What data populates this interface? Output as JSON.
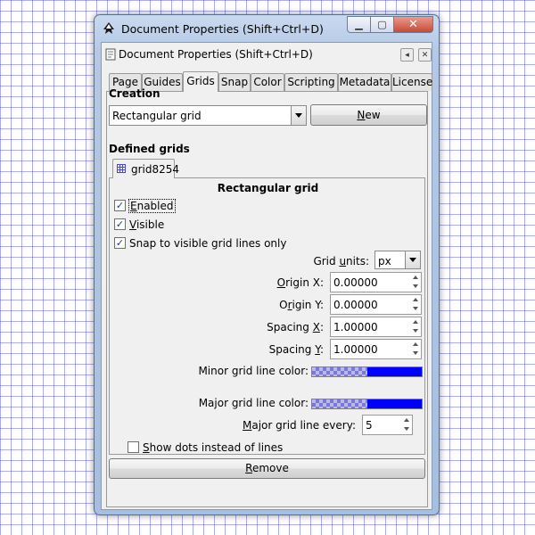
{
  "window": {
    "title": "Document Properties (Shift+Ctrl+D)",
    "minimize_icon": "minimize-icon",
    "maximize_icon": "maximize-icon",
    "close_icon": "close-icon"
  },
  "panel": {
    "title": "Document Properties (Shift+Ctrl+D)",
    "undock_icon": "undock-icon",
    "close_icon": "close-icon"
  },
  "tabs": [
    {
      "label": "Page"
    },
    {
      "label": "Guides"
    },
    {
      "label": "Grids",
      "active": true
    },
    {
      "label": "Snap"
    },
    {
      "label": "Color"
    },
    {
      "label": "Scripting"
    },
    {
      "label": "Metadata"
    },
    {
      "label": "License"
    }
  ],
  "creation": {
    "heading": "Creation",
    "grid_type": "Rectangular grid",
    "new_button": {
      "pre": "",
      "mnemonic": "N",
      "post": "ew"
    }
  },
  "defined_grids": {
    "heading": "Defined grids",
    "grid_tab": "grid8254",
    "grid_heading": "Rectangular grid",
    "enabled": {
      "mnemonic": "E",
      "rest": "nabled",
      "checked": true
    },
    "visible": {
      "mnemonic": "V",
      "rest": "isible",
      "checked": true
    },
    "snap_visible": {
      "label": "Snap to visible grid lines only",
      "checked": true
    },
    "grid_units": {
      "pre": "Grid ",
      "mnemonic": "u",
      "post": "nits:",
      "value": "px"
    },
    "origin_x": {
      "pre": "",
      "mnemonic": "O",
      "post": "rigin X:",
      "value": "0.00000"
    },
    "origin_y": {
      "pre": "O",
      "mnemonic": "r",
      "post": "igin Y:",
      "value": "0.00000"
    },
    "spacing_x": {
      "pre": "Spacing ",
      "mnemonic": "X",
      "post": ":",
      "value": "1.00000"
    },
    "spacing_y": {
      "pre": "Spacing ",
      "mnemonic": "Y",
      "post": ":",
      "value": "1.00000"
    },
    "minor_color": {
      "label": "Minor grid line color:",
      "color": "#0000ff"
    },
    "major_color": {
      "label": "Major grid line color:",
      "color": "#0000ff"
    },
    "major_every": {
      "pre": "",
      "mnemonic": "M",
      "post": "ajor grid line every:",
      "value": "5"
    },
    "show_dots": {
      "mnemonic": "S",
      "rest": "how dots instead of lines",
      "checked": false
    }
  },
  "remove_button": {
    "mnemonic": "R",
    "rest": "emove"
  }
}
